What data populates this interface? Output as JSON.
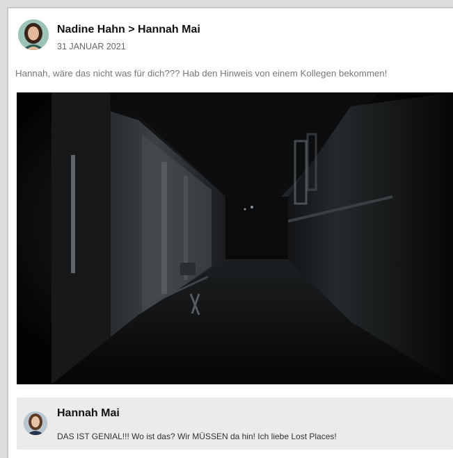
{
  "post": {
    "author_line": "Nadine Hahn > Hannah Mai",
    "date": "31 JANUAR 2021",
    "text": "Hannah, wäre das nicht was für dich??? Hab den Hinweis von einem Kollegen bekommen!",
    "image": "dark-abandoned-corridor-photo"
  },
  "comment": {
    "author": "Hannah Mai",
    "text": "DAS IST GENIAL!!! Wo ist das? Wir MÜSSEN da hin! Ich liebe Lost Places!"
  },
  "colors": {
    "background": "#dcdcdc",
    "card": "#ffffff",
    "comment_bg": "#ebebeb",
    "muted_text": "#777777"
  }
}
